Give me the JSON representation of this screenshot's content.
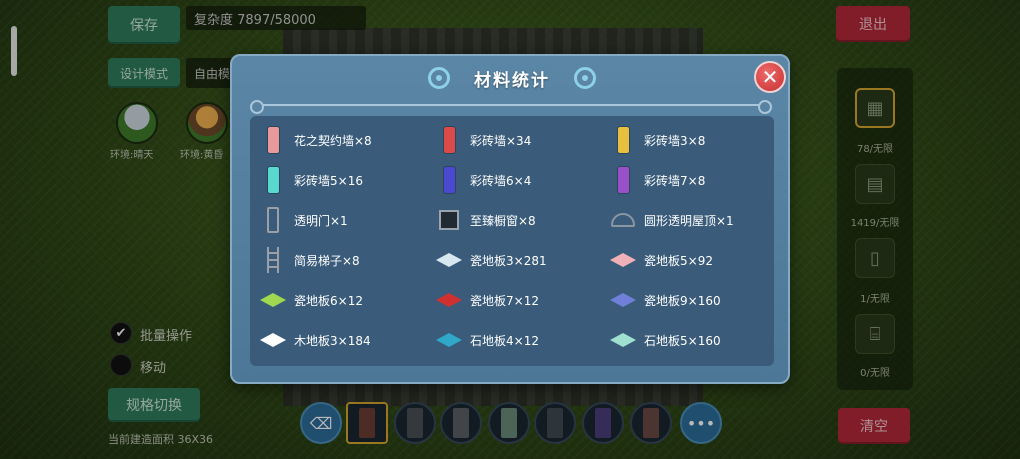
{
  "hud": {
    "save_label": "保存",
    "complexity_text": "复杂度 7897/58000",
    "mode_label": "设计模式",
    "mode_value": "自由模",
    "env_labels": [
      "环境:晴天",
      "环境:黄昏"
    ],
    "exit_label": "退出",
    "checkbox_labels": [
      "批量操作",
      "移动"
    ],
    "spec_switch_label": "规格切换",
    "bottom_info": "当前建造面积 36X36",
    "clear_label": "清空",
    "right_labels": [
      "78/无限",
      "1419/无限",
      "1/无限",
      "0/无限"
    ],
    "more_icon": "more-icon"
  },
  "modal": {
    "title": "材料统计",
    "close_icon": "close-icon",
    "items": [
      {
        "label": "花之契约墙×8",
        "icon": "wall",
        "color": "#e89a9a"
      },
      {
        "label": "彩砖墙×34",
        "icon": "wall",
        "color": "#d94a4a"
      },
      {
        "label": "彩砖墙3×8",
        "icon": "wall",
        "color": "#e8c040"
      },
      {
        "label": "彩砖墙5×16",
        "icon": "wall",
        "color": "#5ad8d0"
      },
      {
        "label": "彩砖墙6×4",
        "icon": "wall",
        "color": "#4a4ad0"
      },
      {
        "label": "彩砖墙7×8",
        "icon": "wall",
        "color": "#9a50c8"
      },
      {
        "label": "透明门×1",
        "icon": "door",
        "color": "#9aa0a6"
      },
      {
        "label": "至臻橱窗×8",
        "icon": "window",
        "color": "#222a33"
      },
      {
        "label": "圆形透明屋顶×1",
        "icon": "roof",
        "color": "#8a96a0"
      },
      {
        "label": "简易梯子×8",
        "icon": "ladder",
        "color": "#9aa0a6"
      },
      {
        "label": "瓷地板3×281",
        "icon": "floor",
        "color": "#d8e8f0"
      },
      {
        "label": "瓷地板5×92",
        "icon": "floor",
        "color": "#f0b0b8"
      },
      {
        "label": "瓷地板6×12",
        "icon": "floor",
        "color": "#a0d850"
      },
      {
        "label": "瓷地板7×12",
        "icon": "floor",
        "color": "#d03030"
      },
      {
        "label": "瓷地板9×160",
        "icon": "floor",
        "color": "#7080d8"
      },
      {
        "label": "木地板3×184",
        "icon": "floor",
        "color": "#ffffff"
      },
      {
        "label": "石地板4×12",
        "icon": "floor",
        "color": "#30a8c8"
      },
      {
        "label": "石地板5×160",
        "icon": "floor",
        "color": "#a0e0d0"
      }
    ]
  }
}
